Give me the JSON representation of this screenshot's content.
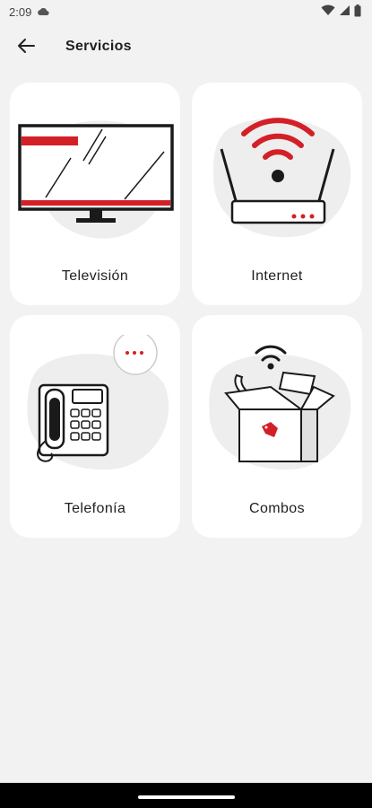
{
  "status_bar": {
    "time": "2:09",
    "icons": [
      "cloud-icon",
      "wifi-icon",
      "signal-icon",
      "battery-icon"
    ]
  },
  "header": {
    "back_icon": "arrow-left-icon",
    "title": "Servicios"
  },
  "services": [
    {
      "label": "Televisión",
      "icon": "tv-icon"
    },
    {
      "label": "Internet",
      "icon": "router-icon"
    },
    {
      "label": "Telefonía",
      "icon": "phone-icon"
    },
    {
      "label": "Combos",
      "icon": "box-icon"
    }
  ],
  "colors": {
    "accent": "#d32027",
    "background": "#f2f2f2",
    "card": "#ffffff",
    "blob": "#eeeeee",
    "ink": "#1a1a1a"
  }
}
